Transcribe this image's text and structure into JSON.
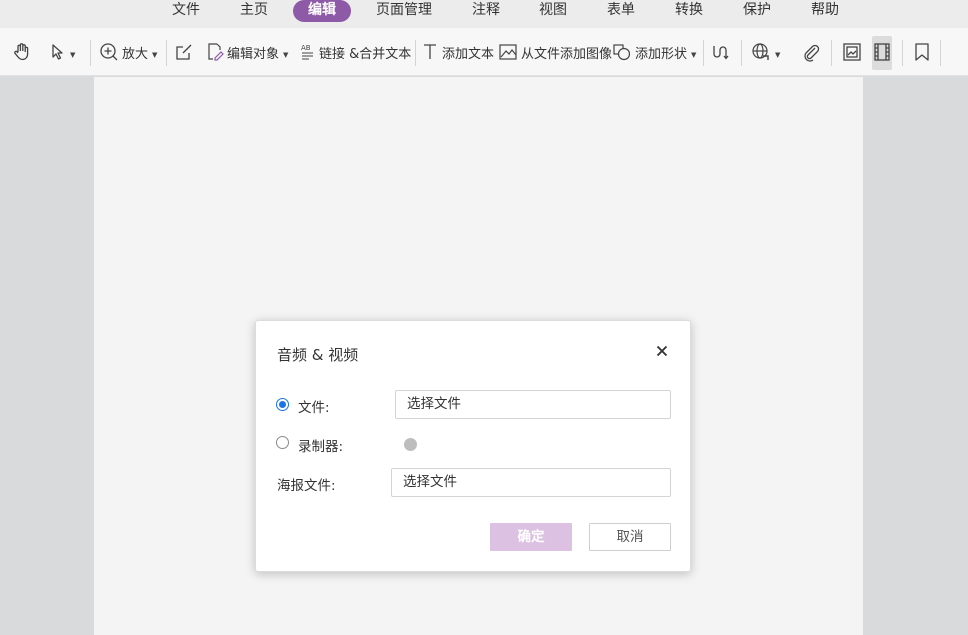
{
  "menu": {
    "items": [
      {
        "label": "文件"
      },
      {
        "label": "主页"
      },
      {
        "label": "编辑",
        "active": true
      },
      {
        "label": "页面管理"
      },
      {
        "label": "注释"
      },
      {
        "label": "视图"
      },
      {
        "label": "表单"
      },
      {
        "label": "转换"
      },
      {
        "label": "保护"
      },
      {
        "label": "帮助"
      }
    ]
  },
  "toolbar": {
    "zoom_label": "放大",
    "edit_object_label": "编辑对象",
    "link_merge_label": "链接 &合并文本",
    "add_text_label": "添加文本",
    "add_image_label": "从文件添加图像",
    "add_shape_label": "添加形状"
  },
  "dialog": {
    "title": "音频 & 视频",
    "file_label": "文件:",
    "file_value": "选择文件",
    "recorder_label": "录制器:",
    "poster_label": "海报文件:",
    "poster_value": "选择文件",
    "ok_label": "确定",
    "cancel_label": "取消"
  },
  "colors": {
    "accent": "#8e5aa8",
    "ok_button": "#dcc1e3",
    "radio_checked": "#1a73e8"
  }
}
